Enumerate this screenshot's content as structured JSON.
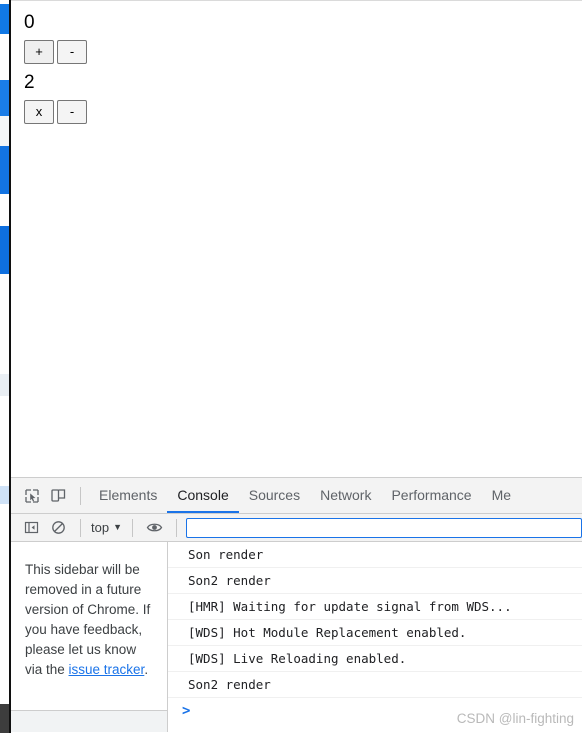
{
  "page": {
    "counter1": {
      "value": "0",
      "buttons": [
        {
          "label": "+",
          "name": "increment-button"
        },
        {
          "label": "-",
          "name": "decrement-button"
        }
      ]
    },
    "counter2": {
      "value": "2",
      "buttons": [
        {
          "label": "x",
          "name": "multiply-button"
        },
        {
          "label": "-",
          "name": "decrement2-button"
        }
      ]
    }
  },
  "devtools": {
    "tabs": [
      {
        "label": "Elements",
        "active": false
      },
      {
        "label": "Console",
        "active": true
      },
      {
        "label": "Sources",
        "active": false
      },
      {
        "label": "Network",
        "active": false
      },
      {
        "label": "Performance",
        "active": false
      },
      {
        "label": "Me",
        "active": false
      }
    ],
    "icons": {
      "inspect": "inspect-element-icon",
      "device": "device-toolbar-icon",
      "sidebar_toggle": "show-console-sidebar-icon",
      "clear": "clear-console-icon",
      "eye": "create-live-expression-icon"
    },
    "console_toolbar": {
      "context": "top",
      "context_caret": "▼",
      "filter_value": "",
      "filter_placeholder": ""
    },
    "sidebar": {
      "notice_part1": "This sidebar will be removed in a future version of Chrome. If you have feedback, please let us know via the ",
      "notice_link": "issue tracker",
      "notice_part2": "."
    },
    "messages": [
      {
        "text": "Son render"
      },
      {
        "text": "Son2 render"
      },
      {
        "text": "[HMR] Waiting for update signal from WDS..."
      },
      {
        "text": "[WDS] Hot Module Replacement enabled."
      },
      {
        "text": "[WDS] Live Reloading enabled."
      },
      {
        "text": "Son2 render"
      }
    ],
    "prompt_caret": ">",
    "watermark": "CSDN @lin-fighting"
  },
  "colors": {
    "accent": "#1a73e8",
    "toolbar_bg": "#f3f3f3",
    "text": "#202124",
    "muted": "#5f6368",
    "watermark": "#b9b9b9"
  }
}
